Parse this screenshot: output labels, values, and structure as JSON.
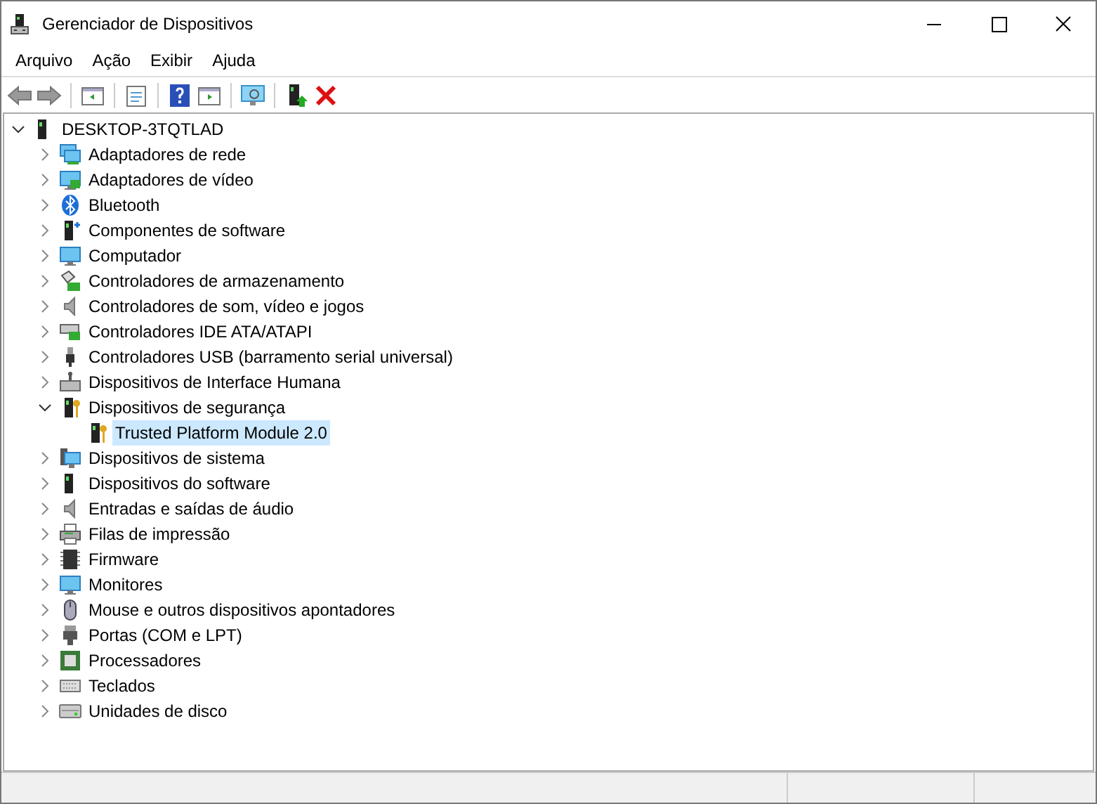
{
  "window": {
    "title": "Gerenciador de Dispositivos"
  },
  "menu": [
    "Arquivo",
    "Ação",
    "Exibir",
    "Ajuda"
  ],
  "tree": {
    "label": "DESKTOP-3TQTLAD",
    "expanded": true,
    "selected": false,
    "children": [
      {
        "label": "Adaptadores de rede",
        "expanded": false,
        "selected": false
      },
      {
        "label": "Adaptadores de vídeo",
        "expanded": false,
        "selected": false
      },
      {
        "label": "Bluetooth",
        "expanded": false,
        "selected": false
      },
      {
        "label": "Componentes de software",
        "expanded": false,
        "selected": false
      },
      {
        "label": "Computador",
        "expanded": false,
        "selected": false
      },
      {
        "label": "Controladores de armazenamento",
        "expanded": false,
        "selected": false
      },
      {
        "label": "Controladores de som, vídeo e jogos",
        "expanded": false,
        "selected": false
      },
      {
        "label": "Controladores IDE ATA/ATAPI",
        "expanded": false,
        "selected": false
      },
      {
        "label": "Controladores USB (barramento serial universal)",
        "expanded": false,
        "selected": false
      },
      {
        "label": "Dispositivos de Interface Humana",
        "expanded": false,
        "selected": false
      },
      {
        "label": "Dispositivos de segurança",
        "expanded": true,
        "selected": false,
        "children": [
          {
            "label": "Trusted Platform Module 2.0",
            "selected": true
          }
        ]
      },
      {
        "label": "Dispositivos de sistema",
        "expanded": false,
        "selected": false
      },
      {
        "label": "Dispositivos do software",
        "expanded": false,
        "selected": false
      },
      {
        "label": "Entradas e saídas de áudio",
        "expanded": false,
        "selected": false
      },
      {
        "label": "Filas de impressão",
        "expanded": false,
        "selected": false
      },
      {
        "label": "Firmware",
        "expanded": false,
        "selected": false
      },
      {
        "label": "Monitores",
        "expanded": false,
        "selected": false
      },
      {
        "label": "Mouse e outros dispositivos apontadores",
        "expanded": false,
        "selected": false
      },
      {
        "label": "Portas (COM e LPT)",
        "expanded": false,
        "selected": false
      },
      {
        "label": "Processadores",
        "expanded": false,
        "selected": false
      },
      {
        "label": "Teclados",
        "expanded": false,
        "selected": false
      },
      {
        "label": "Unidades de disco",
        "expanded": false,
        "selected": false
      }
    ]
  }
}
